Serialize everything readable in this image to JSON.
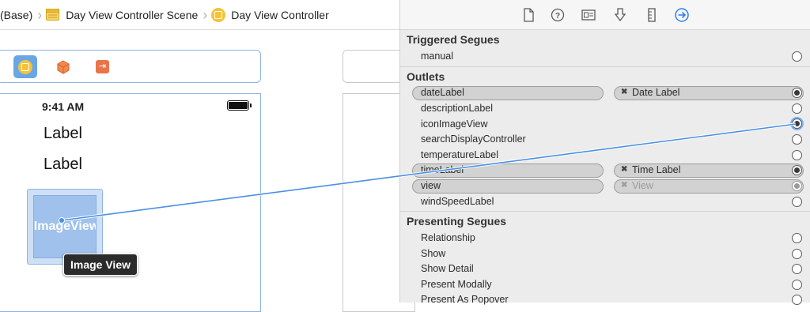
{
  "breadcrumb": {
    "items": [
      {
        "label": "(Base)"
      },
      {
        "label": "Day View Controller Scene"
      },
      {
        "label": "Day View Controller"
      }
    ]
  },
  "canvas": {
    "status_time": "9:41 AM",
    "labels": [
      "Label",
      "Label"
    ],
    "image_view_text": "ImageView",
    "tooltip": "Image View"
  },
  "inspector": {
    "toolbar_icons": [
      "file-icon",
      "help-icon",
      "identity-icon",
      "attributes-icon",
      "size-icon",
      "connections-icon"
    ],
    "sections": {
      "triggered": {
        "title": "Triggered Segues",
        "rows": [
          {
            "label": "manual"
          }
        ]
      },
      "outlets": {
        "title": "Outlets",
        "rows": [
          {
            "label": "dateLabel",
            "connection": "Date Label"
          },
          {
            "label": "descriptionLabel"
          },
          {
            "label": "iconImageView"
          },
          {
            "label": "searchDisplayController"
          },
          {
            "label": "temperatureLabel"
          },
          {
            "label": "timeLabel",
            "connection": "Time Label"
          },
          {
            "label": "view",
            "connection": "View"
          },
          {
            "label": "windSpeedLabel"
          }
        ]
      },
      "presenting": {
        "title": "Presenting Segues",
        "rows": [
          {
            "label": "Relationship"
          },
          {
            "label": "Show"
          },
          {
            "label": "Show Detail"
          },
          {
            "label": "Present Modally"
          },
          {
            "label": "Present As Popover"
          }
        ]
      }
    }
  },
  "colors": {
    "connection_line": "#4a90e2",
    "selection_blue": "#6aa6e6",
    "controller_yellow": "#f5c33a"
  }
}
